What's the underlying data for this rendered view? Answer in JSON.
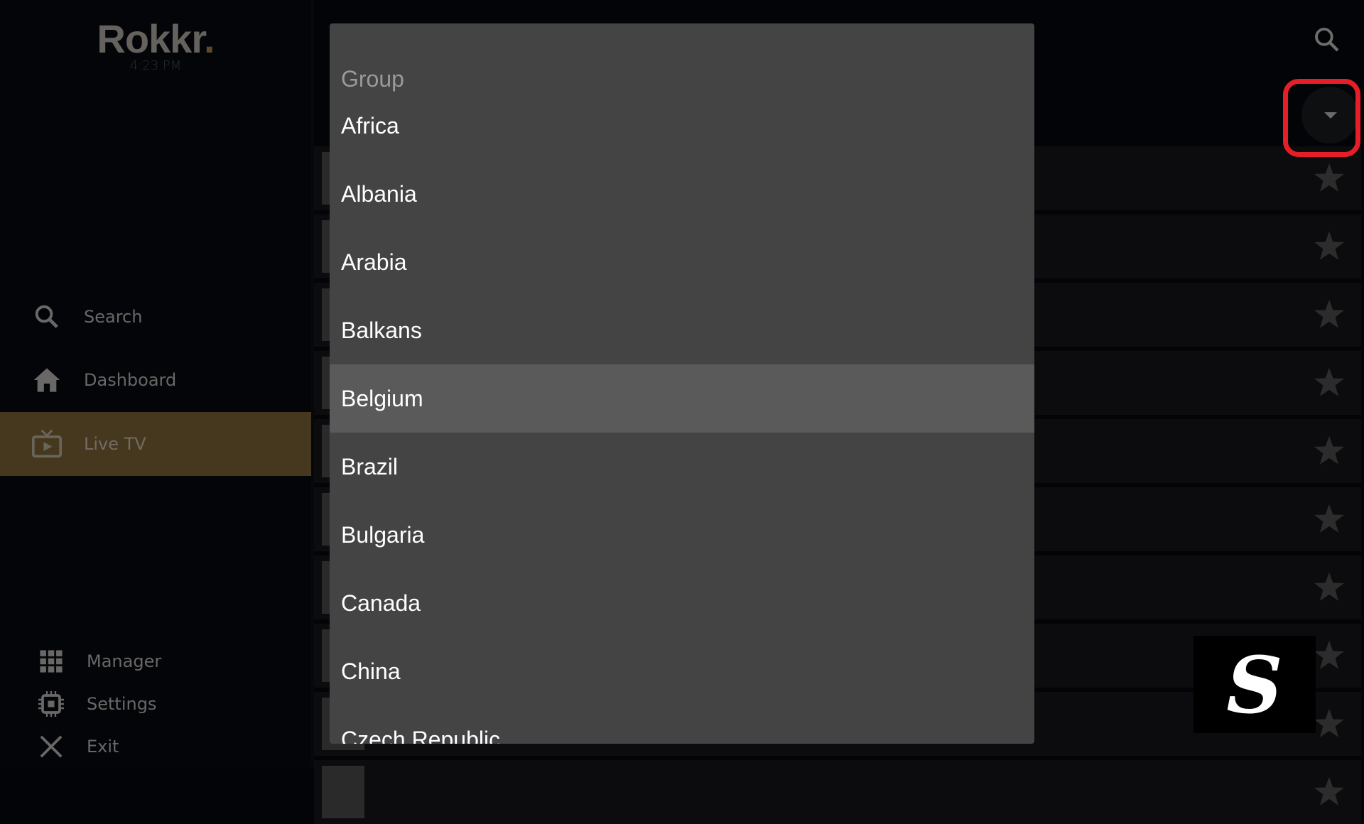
{
  "app": {
    "logo": "Rokkr",
    "logo_dot": ".",
    "time": "4:23 PM"
  },
  "sidebar": {
    "items": [
      {
        "label": "Search",
        "icon": "search-icon"
      },
      {
        "label": "Dashboard",
        "icon": "home-icon"
      },
      {
        "label": "Live TV",
        "icon": "tv-icon",
        "active": true
      },
      {
        "label": "Manager",
        "icon": "grid-icon"
      },
      {
        "label": "Settings",
        "icon": "chip-icon"
      },
      {
        "label": "Exit",
        "icon": "close-icon"
      }
    ]
  },
  "colors": {
    "accent": "#45381e",
    "highlight": "#e61e28",
    "dropdown_bg": "#444444",
    "selected_bg": "#5a5a5a"
  },
  "dropdown": {
    "title": "Group",
    "selected": "Belgium",
    "options": [
      "Africa",
      "Albania",
      "Arabia",
      "Balkans",
      "Belgium",
      "Brazil",
      "Bulgaria",
      "Canada",
      "China",
      "Czech Republic"
    ]
  },
  "watermark": {
    "text": "S"
  }
}
